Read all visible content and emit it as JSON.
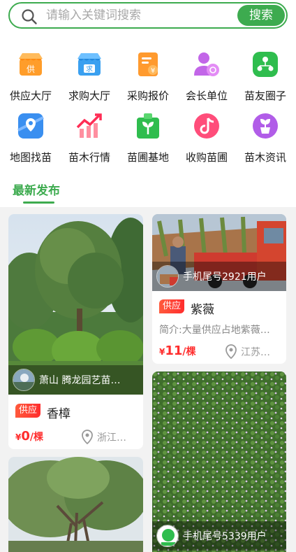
{
  "search": {
    "placeholder": "请输入关键词搜索",
    "button": "搜索"
  },
  "categories": [
    {
      "label": "供应大厅",
      "icon": "supply-hall-icon",
      "glyph": "供",
      "color": "#ff9d2a"
    },
    {
      "label": "求购大厅",
      "icon": "purchase-hall-icon",
      "glyph": "求",
      "color": "#3aa0f0"
    },
    {
      "label": "采购报价",
      "icon": "quote-icon",
      "glyph": "¥",
      "color": "#ff9a2e"
    },
    {
      "label": "会长单位",
      "icon": "president-unit-icon",
      "glyph": "",
      "color": "#c266e8"
    },
    {
      "label": "苗友圈子",
      "icon": "friends-circle-icon",
      "glyph": "",
      "color": "#2fbd4e"
    },
    {
      "label": "地图找苗",
      "icon": "map-icon",
      "glyph": "",
      "color": "#3a8ff0"
    },
    {
      "label": "苗木行情",
      "icon": "market-trend-icon",
      "glyph": "",
      "color": "#ff4d6a"
    },
    {
      "label": "苗圃基地",
      "icon": "nursery-base-icon",
      "glyph": "",
      "color": "#2fbd4e"
    },
    {
      "label": "收购苗圃",
      "icon": "acquire-nursery-icon",
      "glyph": "",
      "color": "#ff4d7a"
    },
    {
      "label": "苗木资讯",
      "icon": "news-icon",
      "glyph": "",
      "color": "#b15de8"
    }
  ],
  "tabs": {
    "latest": "最新发布"
  },
  "accent": "#3dab4f",
  "cards": [
    {
      "user": "萧山 腾龙园艺苗…",
      "tag": "供应",
      "title": "香樟",
      "currency": "¥",
      "price": "0",
      "unit": "/棵",
      "location": "浙江…"
    },
    {
      "user": "手机尾号2921用户",
      "tag": "供应",
      "title": "紫薇",
      "desc": "简介:大量供应占地紫薇…",
      "currency": "¥",
      "price": "11",
      "unit": "/棵",
      "location": "江苏…"
    },
    {
      "user": "手机尾号5339用户"
    },
    {
      "user": ""
    }
  ]
}
